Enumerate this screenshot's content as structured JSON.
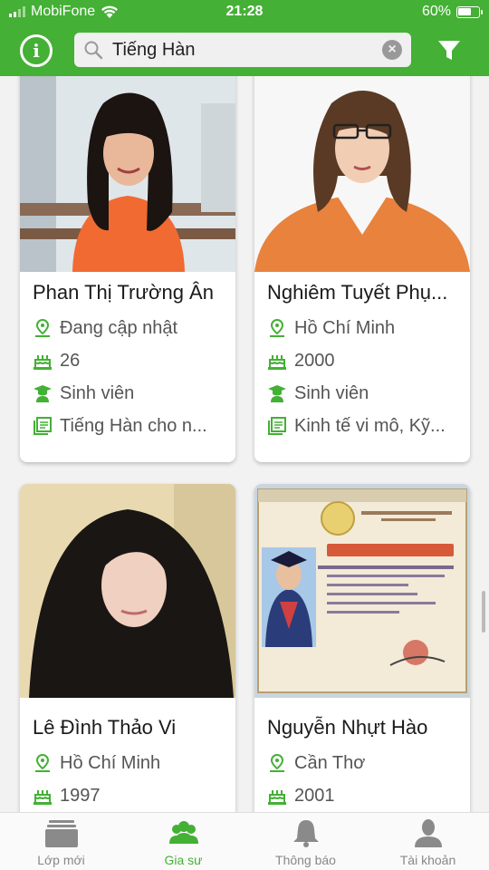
{
  "status": {
    "carrier": "MobiFone",
    "time": "21:28",
    "battery": "60%"
  },
  "search": {
    "value": "Tiếng Hàn"
  },
  "colors": {
    "brand": "#44b035",
    "icon": "#44b035"
  },
  "tutors": [
    {
      "name": "Phan Thị Trường Ân",
      "location": "Đang cập nhật",
      "birth": "26",
      "level": "Sinh viên",
      "subjects": "Tiếng Hàn cho n..."
    },
    {
      "name": "Nghiêm Tuyết Phụ...",
      "location": "Hồ Chí Minh",
      "birth": "2000",
      "level": "Sinh viên",
      "subjects": "Kinh tế vi mô, Kỹ..."
    },
    {
      "name": "Lê Đình Thảo Vi",
      "location": "Hồ Chí Minh",
      "birth": "1997"
    },
    {
      "name": "Nguyễn Nhựt Hào",
      "location": "Cần Thơ",
      "birth": "2001"
    }
  ],
  "tabs": [
    {
      "label": "Lớp mới",
      "icon": "class-icon",
      "active": false
    },
    {
      "label": "Gia sư",
      "icon": "tutors-icon",
      "active": true
    },
    {
      "label": "Thông báo",
      "icon": "bell-icon",
      "active": false
    },
    {
      "label": "Tài khoản",
      "icon": "account-icon",
      "active": false
    }
  ]
}
